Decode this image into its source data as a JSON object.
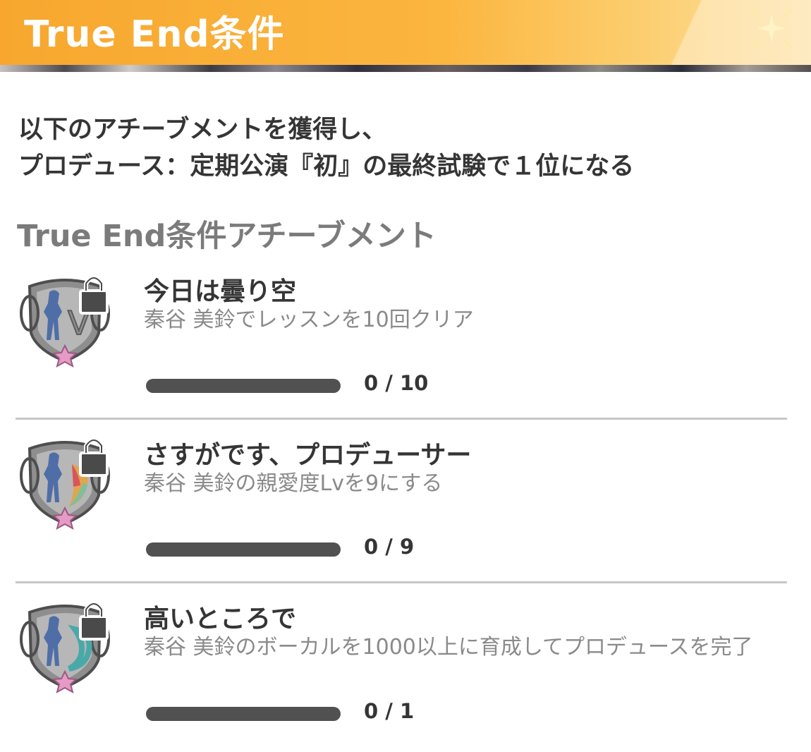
{
  "header": {
    "title": "True End条件"
  },
  "intro": {
    "line1": "以下のアチーブメントを獲得し、",
    "line2": "プロデュース：定期公演『初』の最終試験で１位になる"
  },
  "section_title": "True End条件アチーブメント",
  "colors": {
    "header_orange": "#f7a72e",
    "bar_track": "#515151",
    "divider": "#c6c6c6"
  },
  "achievements": [
    {
      "name": "今日は曇り空",
      "description": "秦谷 美鈴でレッスンを10回クリア",
      "progress": 0,
      "goal": 10,
      "progress_text": "0 / 10",
      "icon": "locked-badge-icon"
    },
    {
      "name": "さすがです、プロデューサー",
      "description": "秦谷 美鈴の親愛度Lvを9にする",
      "progress": 0,
      "goal": 9,
      "progress_text": "0 / 9",
      "icon": "locked-badge-icon"
    },
    {
      "name": "高いところで",
      "description": "秦谷 美鈴のボーカルを1000以上に育成してプロデュースを完了",
      "progress": 0,
      "goal": 1,
      "progress_text": "0 / 1",
      "icon": "locked-badge-icon"
    }
  ]
}
